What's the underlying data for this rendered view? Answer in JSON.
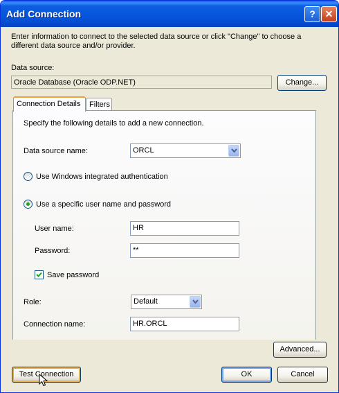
{
  "window": {
    "title": "Add Connection",
    "help_label": "?",
    "close_label": "✕"
  },
  "intro": {
    "line1": "Enter information to connect to the selected data source or click \"Change\" to choose a",
    "line2": "different data source and/or provider."
  },
  "data_source": {
    "label": "Data source:",
    "value": "Oracle Database (Oracle ODP.NET)",
    "change_button": "Change..."
  },
  "tabs": [
    {
      "label": "Connection Details",
      "active": true
    },
    {
      "label": "Filters",
      "active": false
    }
  ],
  "details": {
    "instructions": "Specify the following details to add a new connection.",
    "data_source_name_label": "Data source name:",
    "data_source_name_value": "ORCL",
    "radio_windows_auth": "Use Windows integrated authentication",
    "radio_specific_user": "Use a specific user name and password",
    "user_name_label": "User name:",
    "user_name_value": "HR",
    "password_label": "Password:",
    "password_value": "**",
    "save_password_label": "Save password",
    "save_password_checked": true,
    "role_label": "Role:",
    "role_value": "Default",
    "connection_name_label": "Connection name:",
    "connection_name_value": "HR.ORCL"
  },
  "buttons": {
    "advanced": "Advanced...",
    "test_connection": "Test Connection",
    "ok": "OK",
    "cancel": "Cancel"
  },
  "colors": {
    "titlebar": "#0552d8",
    "dialog_bg": "#ece9d8",
    "radio_dot": "#21a121"
  }
}
